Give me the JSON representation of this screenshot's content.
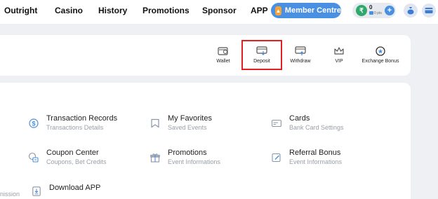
{
  "nav": {
    "items": [
      "Outright",
      "Casino",
      "History",
      "Promotions",
      "Sponsor",
      "APP"
    ],
    "member_centre": "Member Centre"
  },
  "balance": {
    "amount": "0",
    "sub": "0 pts",
    "currency_icon": "rupee-coin-icon"
  },
  "quick_actions": [
    {
      "label": "Wallet",
      "icon": "wallet-icon"
    },
    {
      "label": "Deposit",
      "icon": "deposit-icon"
    },
    {
      "label": "Withdraw",
      "icon": "withdraw-icon"
    },
    {
      "label": "VIP",
      "icon": "crown-icon"
    },
    {
      "label": "Exchange Bonus",
      "icon": "exchange-bonus-icon"
    }
  ],
  "menu": [
    {
      "title": "Transaction Records",
      "subtitle": "Transactions Details",
      "icon": "dollar-icon"
    },
    {
      "title": "My Favorites",
      "subtitle": "Saved Events",
      "icon": "bookmark-icon"
    },
    {
      "title": "Cards",
      "subtitle": "Bank Card Settings",
      "icon": "card-icon"
    },
    {
      "title": "Coupon Center",
      "subtitle": "Coupons, Bet Credits",
      "icon": "coupon-icon"
    },
    {
      "title": "Promotions",
      "subtitle": "Event Informations",
      "icon": "gift-icon"
    },
    {
      "title": "Referral Bonus",
      "subtitle": "Event Informations",
      "icon": "edit-icon"
    },
    {
      "title": "Download APP",
      "subtitle": "",
      "icon": "download-icon"
    }
  ],
  "cutoff_text": "nission",
  "colors": {
    "accent": "#4a90e2",
    "highlight": "#e02020",
    "page_bg": "#eef0f4"
  }
}
